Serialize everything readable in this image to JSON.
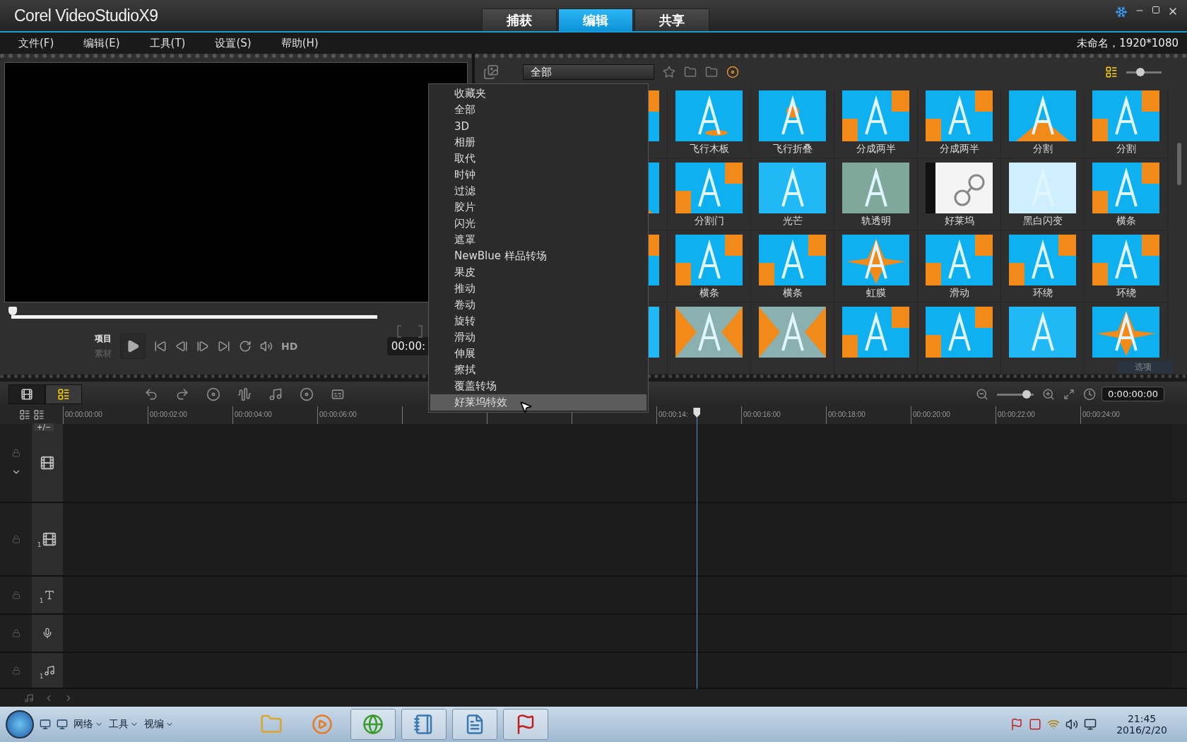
{
  "window": {
    "logo": "Corel VideoStudioX9"
  },
  "tabs": [
    {
      "label": "捕获",
      "selected": false
    },
    {
      "label": "编辑",
      "selected": true
    },
    {
      "label": "共享",
      "selected": false
    }
  ],
  "menu": [
    "文件(F)",
    "编辑(E)",
    "工具(T)",
    "设置(S)",
    "帮助(H)"
  ],
  "project_info": "未命名，1920*1080",
  "player": {
    "scrub": {
      "level": 0
    },
    "modes": [
      {
        "label": "项目",
        "selected": true
      },
      {
        "label": "素材",
        "selected": false
      }
    ],
    "hd": "HD",
    "timecode": "00:00:"
  },
  "library": {
    "category": "全部",
    "zoom": {
      "level": 0.4
    },
    "options_label": "选项",
    "items": [
      {
        "kind": "split"
      },
      {
        "kind": "fly",
        "label": "飞行木板"
      },
      {
        "kind": "fold",
        "label": "飞行折叠"
      },
      {
        "kind": "split",
        "label": "分成两半"
      },
      {
        "kind": "split",
        "label": "分成两半"
      },
      {
        "kind": "wedge",
        "label": "分割"
      },
      {
        "kind": "split",
        "label": "分割"
      },
      {
        "kind": "wedge"
      },
      {
        "kind": "split",
        "label": "分割门"
      },
      {
        "kind": "glow",
        "label": "光芒"
      },
      {
        "kind": "transparent",
        "label": "轨透明"
      },
      {
        "kind": "photo",
        "label": "好莱坞"
      },
      {
        "kind": "flash",
        "label": "黑白闪变"
      },
      {
        "kind": "split",
        "label": "横条"
      },
      {
        "kind": "split"
      },
      {
        "kind": "split",
        "label": "横条"
      },
      {
        "kind": "split",
        "label": "横条"
      },
      {
        "kind": "iris",
        "label": "虹膜"
      },
      {
        "kind": "split",
        "label": "滑动"
      },
      {
        "kind": "split",
        "label": "环绕"
      },
      {
        "kind": "split",
        "label": "环绕"
      },
      {
        "kind": "glow"
      },
      {
        "kind": "pattern"
      },
      {
        "kind": "pattern"
      },
      {
        "kind": "split"
      },
      {
        "kind": "split"
      },
      {
        "kind": "glow"
      },
      {
        "kind": "iris"
      }
    ]
  },
  "dropdown": {
    "items": [
      {
        "label": "收藏夹",
        "selected": false
      },
      {
        "label": "全部",
        "selected": false
      },
      {
        "label": "3D",
        "selected": false
      },
      {
        "label": "相册",
        "selected": false
      },
      {
        "label": "取代",
        "selected": false
      },
      {
        "label": "时钟",
        "selected": false
      },
      {
        "label": "过滤",
        "selected": false
      },
      {
        "label": "胶片",
        "selected": false
      },
      {
        "label": "闪光",
        "selected": false
      },
      {
        "label": "遮罩",
        "selected": false
      },
      {
        "label": "NewBlue 样品转场",
        "selected": false
      },
      {
        "label": "果皮",
        "selected": false
      },
      {
        "label": "推动",
        "selected": false
      },
      {
        "label": "卷动",
        "selected": false
      },
      {
        "label": "旋转",
        "selected": false
      },
      {
        "label": "滑动",
        "selected": false
      },
      {
        "label": "伸展",
        "selected": false
      },
      {
        "label": "擦拭",
        "selected": false
      },
      {
        "label": "覆盖转场",
        "selected": false
      },
      {
        "label": "好莱坞特效",
        "selected": true
      }
    ]
  },
  "timeline": {
    "zoom": {
      "level": 0.8
    },
    "timecode": "0:00:00:00",
    "add_remove": "+/−",
    "playhead": {
      "level": 0.572
    },
    "ruler_left": [
      "00:00:00:00",
      "00:00:02:00",
      "00:00:04:00",
      "00:00:06:00"
    ],
    "ruler_right": [
      "00:00:14:",
      "00:00:16:00",
      "00:00:18:00",
      "00:00:20:00",
      "00:00:22:00",
      "00:00:24:00"
    ],
    "tracks": [
      {
        "kind": "video"
      },
      {
        "kind": "overlay",
        "number": "1"
      },
      {
        "kind": "title",
        "number": "1"
      },
      {
        "kind": "voice"
      },
      {
        "kind": "music",
        "number": "1"
      }
    ]
  },
  "taskbar": {
    "toolbars": [
      "网络",
      "工具",
      "视编"
    ],
    "time": "21:45",
    "date": "2016/2/20"
  }
}
